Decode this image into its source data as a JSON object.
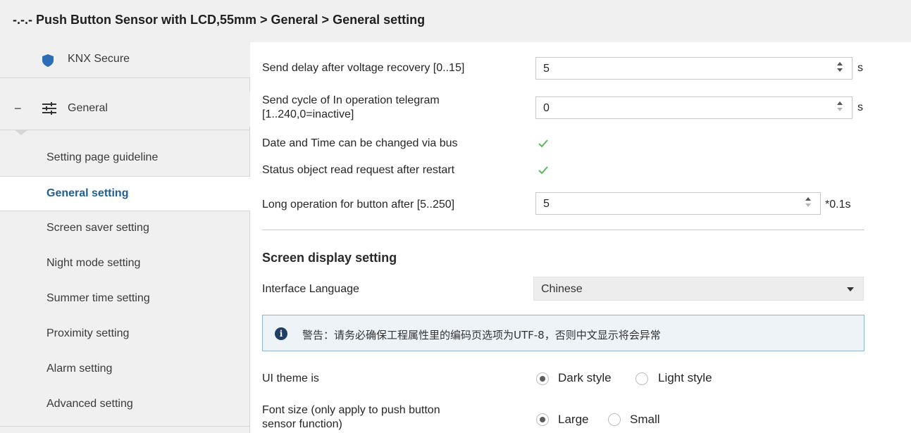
{
  "breadcrumb": "-.-.- Push Button Sensor with LCD,55mm > General > General setting",
  "sidebar": {
    "items": [
      {
        "label": "KNX Secure"
      },
      {
        "label": "General"
      },
      {
        "label": "Setting page guideline"
      },
      {
        "label": "General setting"
      },
      {
        "label": "Screen saver setting"
      },
      {
        "label": "Night mode setting"
      },
      {
        "label": "Summer time setting"
      },
      {
        "label": "Proximity setting"
      },
      {
        "label": "Alarm setting"
      },
      {
        "label": "Advanced setting"
      }
    ],
    "selected": "General setting"
  },
  "main": {
    "send_delay": {
      "label": "Send delay after voltage recovery [0..15]",
      "value": "5",
      "unit": "s"
    },
    "send_cycle": {
      "label_line1": "Send cycle of  In operation telegram",
      "label_line2": "[1..240,0=inactive]",
      "value": "0",
      "unit": "s"
    },
    "date_time": {
      "label": "Date and Time can be changed via bus",
      "checked": true
    },
    "status_read": {
      "label": "Status object read request after restart",
      "checked": true
    },
    "long_op": {
      "label": "Long operation for button after [5..250]",
      "value": "5",
      "unit": "*0.1s"
    },
    "section_title": "Screen display setting",
    "language": {
      "label": "Interface Language",
      "value": "Chinese"
    },
    "warning": "警告：请务必确保工程属性里的编码页选项为UTF-8，否则中文显示将会异常",
    "ui_theme": {
      "label": "UI theme is",
      "options": [
        "Dark style",
        "Light style"
      ],
      "selected": "Dark style"
    },
    "font_size": {
      "label_line1": "Font size (only apply to push button",
      "label_line2": "sensor function)",
      "options": [
        "Large",
        "Small"
      ],
      "selected": "Large"
    }
  },
  "colors": {
    "accent": "#1f5f95",
    "check": "#5cb85c",
    "info_border": "#8fb3d1"
  }
}
